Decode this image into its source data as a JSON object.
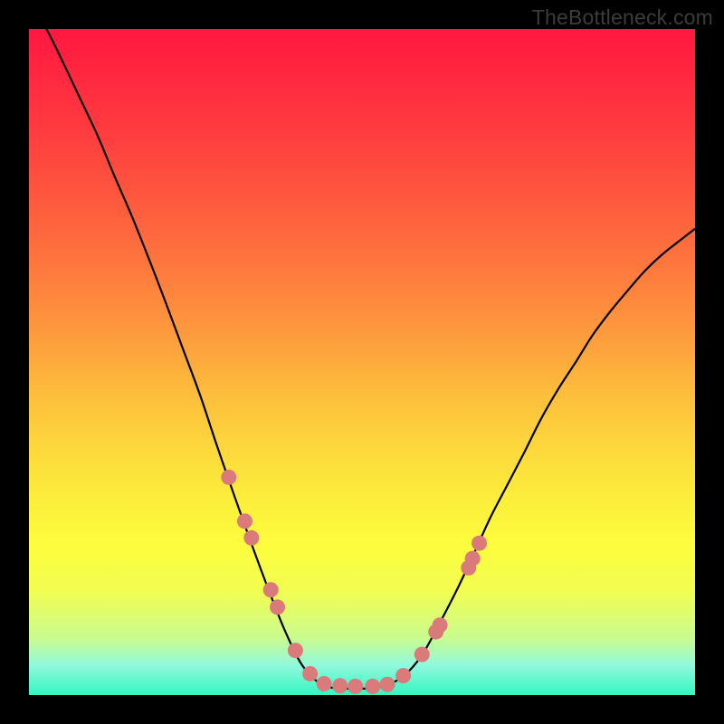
{
  "watermark": "TheBottleneck.com",
  "colors": {
    "frame": "#000000",
    "curve_stroke": "#000000",
    "dot_fill": "#db7a7a",
    "gradient_stops": [
      {
        "offset": 0.0,
        "color": "#ff1740"
      },
      {
        "offset": 0.07,
        "color": "#ff2840"
      },
      {
        "offset": 0.15,
        "color": "#ff3b3f"
      },
      {
        "offset": 0.23,
        "color": "#fe513e"
      },
      {
        "offset": 0.31,
        "color": "#fe693e"
      },
      {
        "offset": 0.39,
        "color": "#fe833d"
      },
      {
        "offset": 0.47,
        "color": "#fd9f3d"
      },
      {
        "offset": 0.54,
        "color": "#fdbb3c"
      },
      {
        "offset": 0.62,
        "color": "#fdd53c"
      },
      {
        "offset": 0.7,
        "color": "#fcec3b"
      },
      {
        "offset": 0.775,
        "color": "#fdfd3d"
      },
      {
        "offset": 0.845,
        "color": "#f1fd52"
      },
      {
        "offset": 0.915,
        "color": "#c9fb90"
      },
      {
        "offset": 0.955,
        "color": "#91f9de"
      },
      {
        "offset": 1.0,
        "color": "#34f6c0"
      }
    ]
  },
  "chart_data": {
    "type": "line",
    "title": "",
    "xlabel": "",
    "ylabel": "",
    "xlim": [
      0,
      1
    ],
    "ylim": [
      0,
      1
    ],
    "note": "Axes are implied (no ticks/labels rendered); y is bottleneck-severity proxy where 0=green/good at bottom, 1=red/bad at top. Values estimated from pixel positions.",
    "series": [
      {
        "name": "bottleneck-curve",
        "x": [
          0.0,
          0.026,
          0.051,
          0.077,
          0.103,
          0.128,
          0.154,
          0.18,
          0.205,
          0.231,
          0.257,
          0.282,
          0.308,
          0.333,
          0.359,
          0.385,
          0.41,
          0.436,
          0.462,
          0.487,
          0.513,
          0.538,
          0.564,
          0.59,
          0.615,
          0.641,
          0.667,
          0.692,
          0.718,
          0.744,
          0.769,
          0.795,
          0.821,
          0.846,
          0.872,
          0.897,
          0.923,
          0.949,
          0.974,
          1.0
        ],
        "y": [
          1.04,
          1.0,
          0.95,
          0.895,
          0.84,
          0.78,
          0.72,
          0.655,
          0.59,
          0.52,
          0.45,
          0.375,
          0.3,
          0.23,
          0.16,
          0.095,
          0.045,
          0.018,
          0.01,
          0.01,
          0.01,
          0.015,
          0.03,
          0.06,
          0.105,
          0.155,
          0.21,
          0.265,
          0.315,
          0.365,
          0.415,
          0.46,
          0.5,
          0.54,
          0.575,
          0.605,
          0.635,
          0.66,
          0.68,
          0.7
        ]
      },
      {
        "name": "marker-dots",
        "x": [
          0.3,
          0.324,
          0.334,
          0.363,
          0.373,
          0.4,
          0.422,
          0.443,
          0.467,
          0.49,
          0.516,
          0.538,
          0.562,
          0.59,
          0.611,
          0.617,
          0.66,
          0.666,
          0.676
        ],
        "y": [
          0.327,
          0.261,
          0.236,
          0.158,
          0.132,
          0.067,
          0.032,
          0.017,
          0.014,
          0.013,
          0.013,
          0.016,
          0.029,
          0.061,
          0.095,
          0.105,
          0.191,
          0.205,
          0.228
        ]
      }
    ]
  }
}
